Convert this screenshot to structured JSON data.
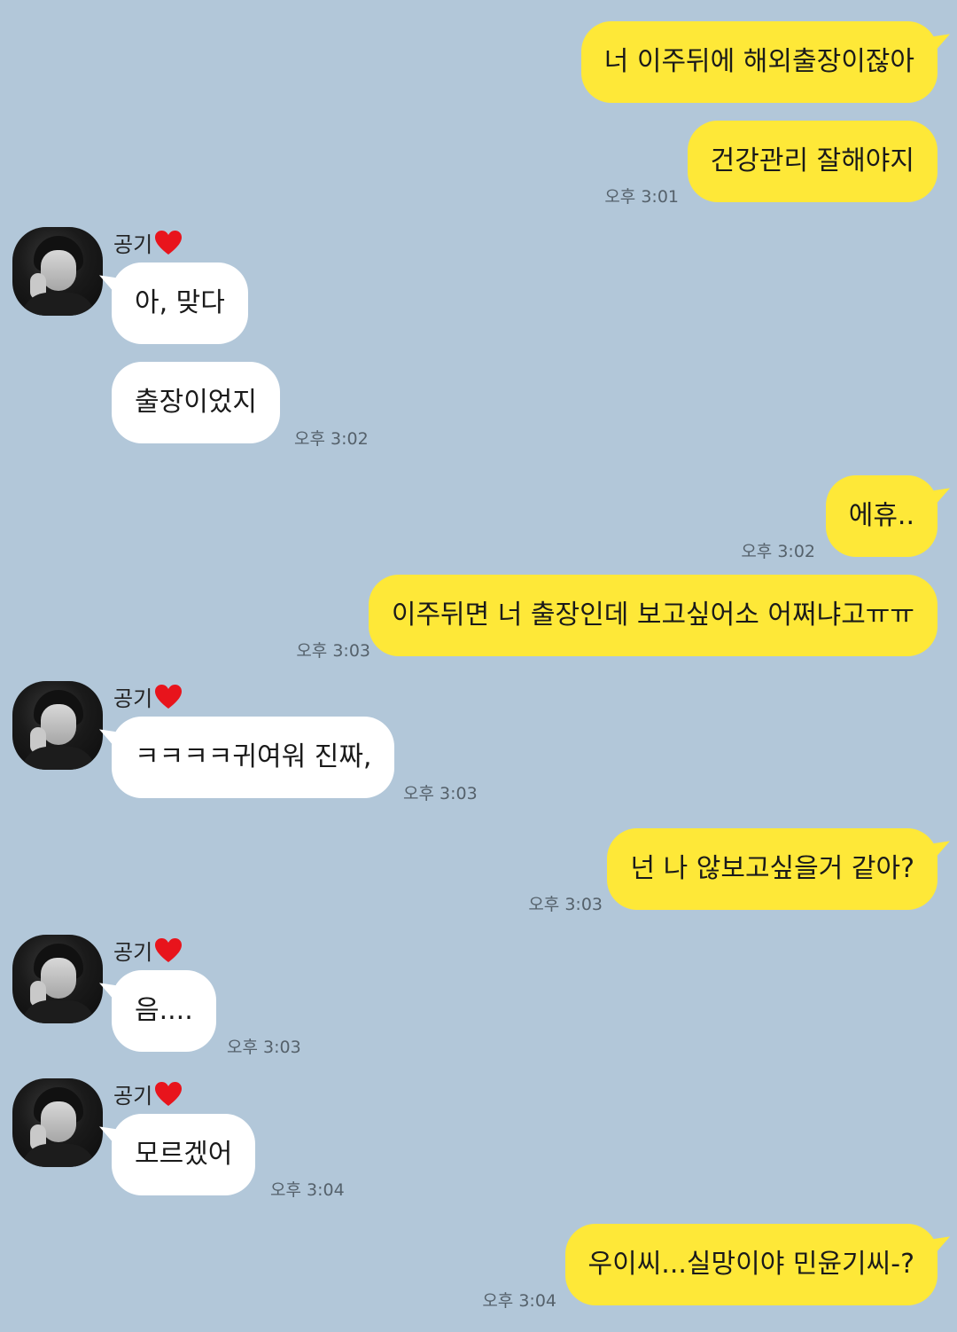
{
  "contact": {
    "name": "공기",
    "heart_color": "#e8141c"
  },
  "colors": {
    "background": "#b2c7d9",
    "my_bubble": "#fee838",
    "their_bubble": "#ffffff"
  },
  "messages": [
    {
      "sender": "me",
      "text": "너 이주뒤에 해외출장이잖아",
      "time": ""
    },
    {
      "sender": "me",
      "text": "건강관리 잘해야지",
      "time": "오후 3:01"
    },
    {
      "sender": "them",
      "text": "아, 맞다",
      "time": ""
    },
    {
      "sender": "them",
      "text": "출장이었지",
      "time": "오후 3:02"
    },
    {
      "sender": "me",
      "text": "에휴..",
      "time": "오후 3:02"
    },
    {
      "sender": "me",
      "text": "이주뒤면 너 출장인데 보고싶어소 어쩌냐고ㅠㅠ",
      "time": "오후 3:03"
    },
    {
      "sender": "them",
      "text": "ㅋㅋㅋㅋ귀여워 진짜,",
      "time": "오후 3:03"
    },
    {
      "sender": "me",
      "text": "넌 나 않보고싶을거 같아?",
      "time": "오후 3:03"
    },
    {
      "sender": "them",
      "text": "음....",
      "time": "오후 3:03"
    },
    {
      "sender": "them",
      "text": "모르겠어",
      "time": "오후 3:04"
    },
    {
      "sender": "me",
      "text": "우이씨...실망이야 민윤기씨-?",
      "time": "오후 3:04"
    }
  ]
}
